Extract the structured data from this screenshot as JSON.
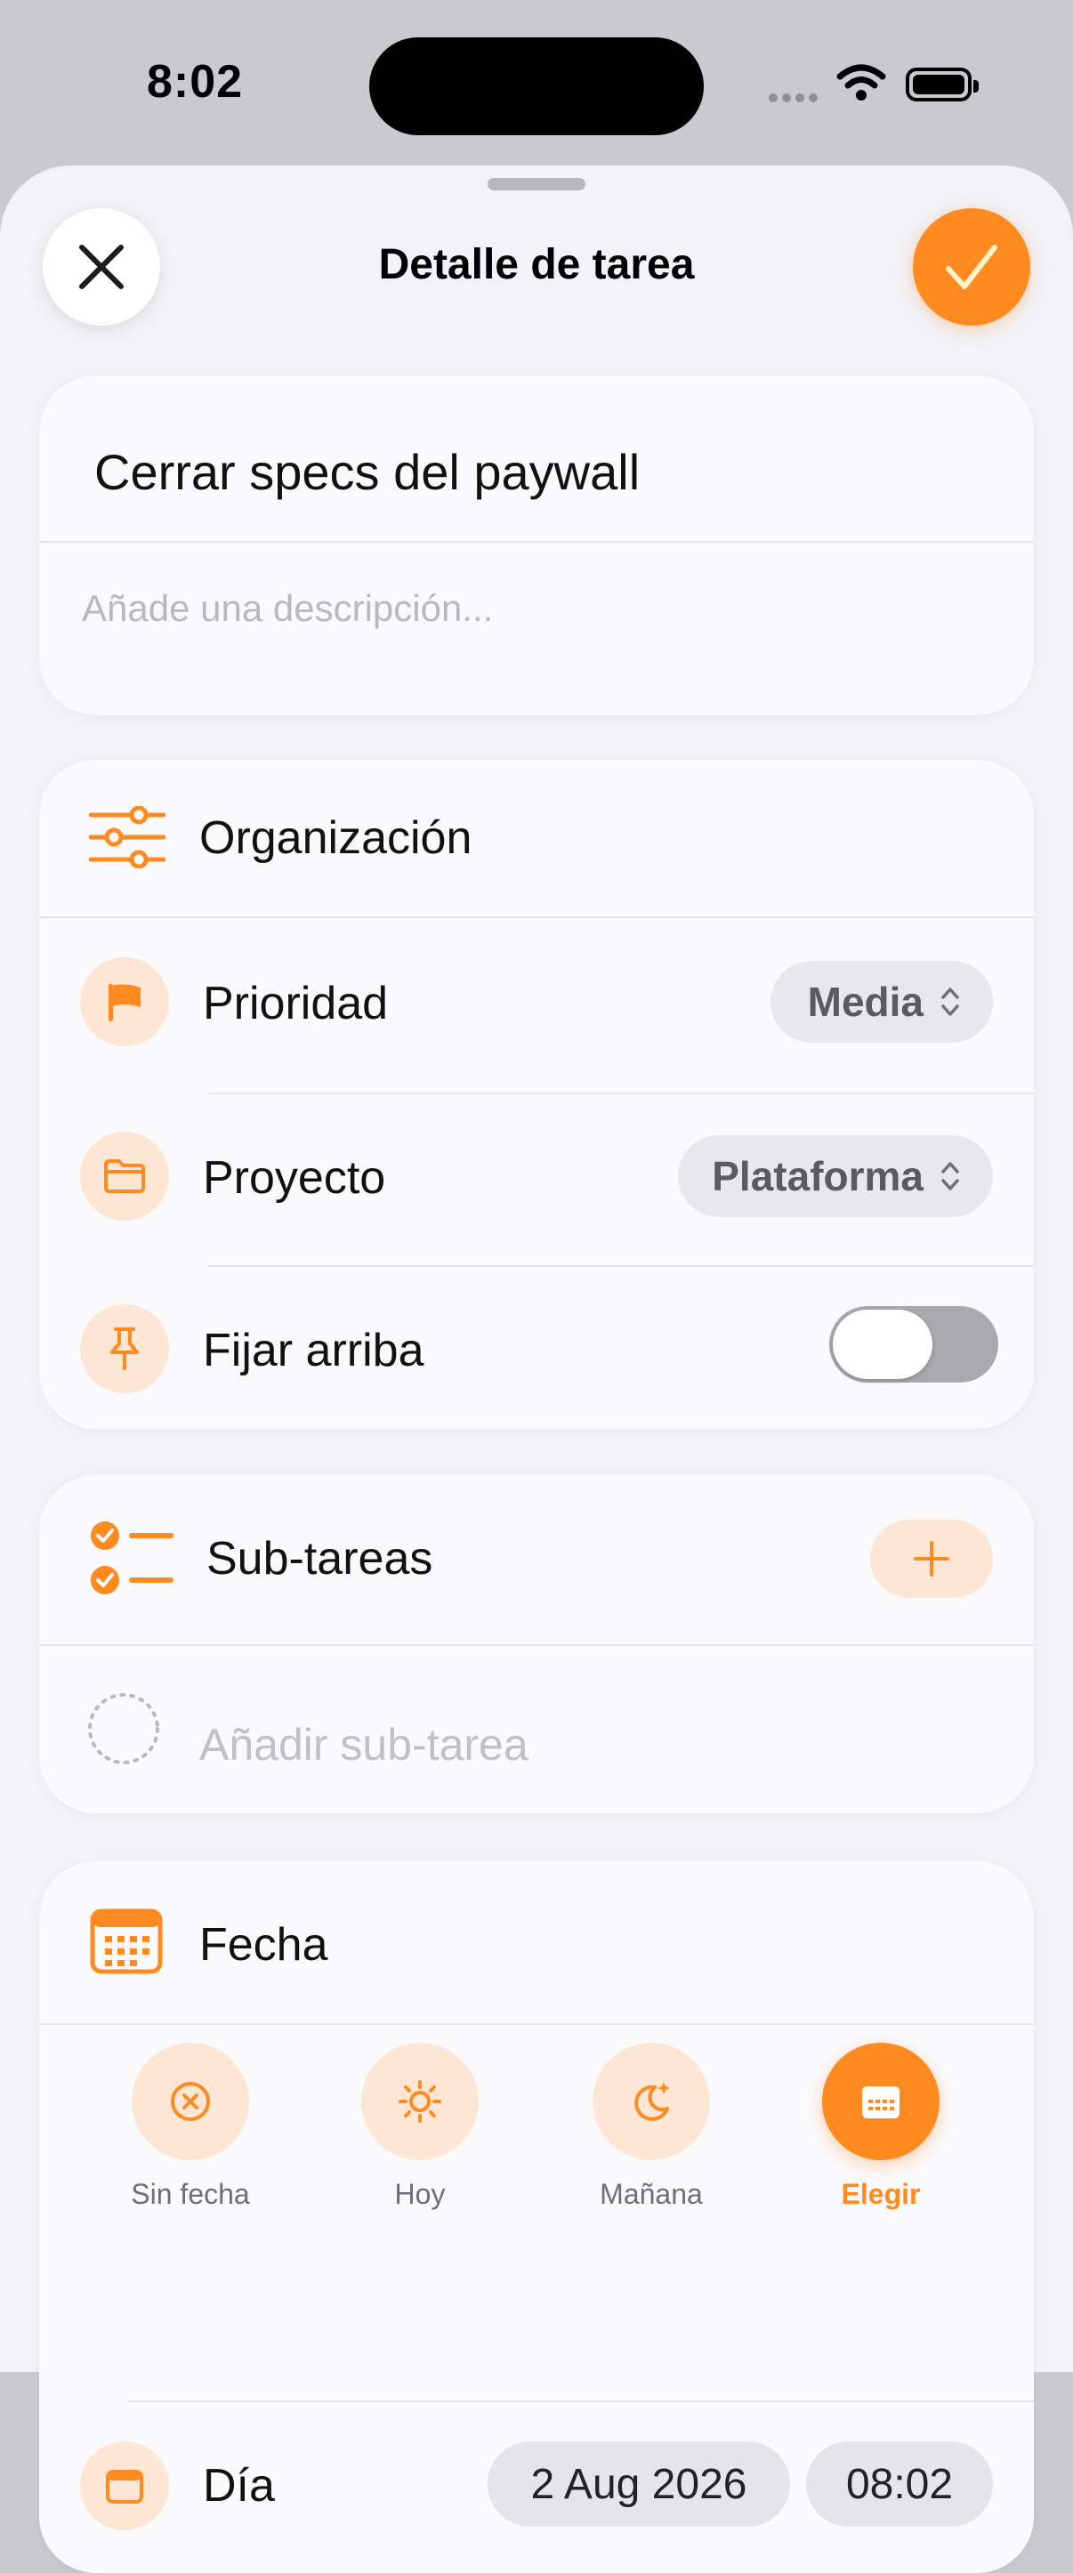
{
  "status_bar": {
    "time": "8:02"
  },
  "header": {
    "title": "Detalle de tarea"
  },
  "task": {
    "title": "Cerrar specs del paywall",
    "description_placeholder": "Añade una descripción..."
  },
  "organization": {
    "heading": "Organización",
    "priority": {
      "label": "Prioridad",
      "value": "Media"
    },
    "project": {
      "label": "Proyecto",
      "value": "Plataforma"
    },
    "pin": {
      "label": "Fijar arriba",
      "enabled": false
    }
  },
  "subtasks": {
    "heading": "Sub-tareas",
    "add_placeholder": "Añadir sub-tarea"
  },
  "date": {
    "heading": "Fecha",
    "options": [
      {
        "label": "Sin fecha",
        "icon": "x-circle-icon"
      },
      {
        "label": "Hoy",
        "icon": "sun-icon"
      },
      {
        "label": "Mañana",
        "icon": "moon-stars-icon"
      },
      {
        "label": "Elegir",
        "icon": "calendar-icon",
        "selected": true
      }
    ],
    "day_label": "Día",
    "day_value": "2 Aug 2026",
    "time_value": "08:02"
  },
  "colors": {
    "accent": "#ff8a1f",
    "accent_soft": "#fde7d4",
    "background": "#f2f2f7"
  }
}
